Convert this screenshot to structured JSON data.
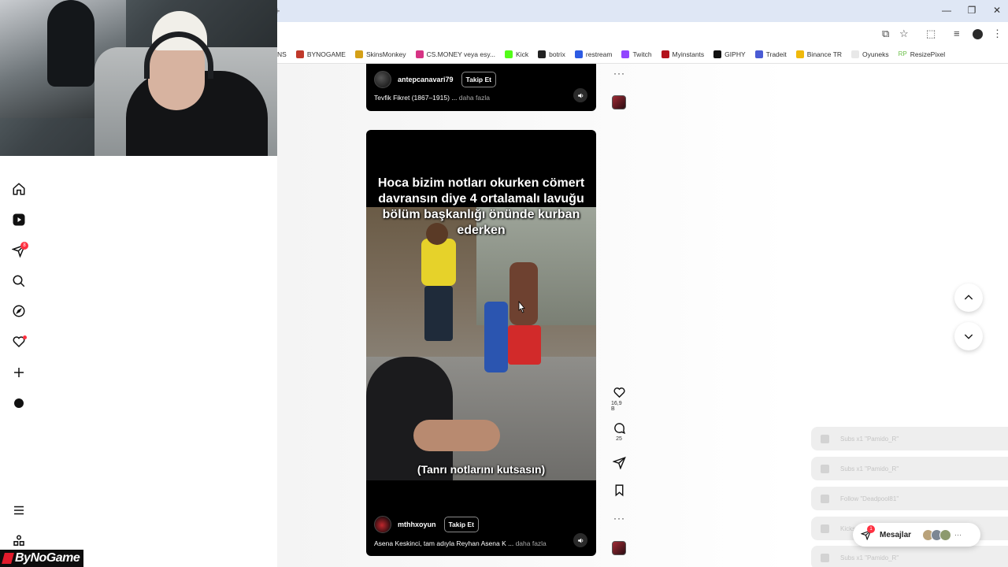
{
  "browser": {
    "bookmarks": [
      {
        "label": "NS",
        "color": "#ffffff"
      },
      {
        "label": "BYNOGAME",
        "color": "#c0392b"
      },
      {
        "label": "SkinsMonkey",
        "color": "#d4a017"
      },
      {
        "label": "CS.MONEY veya esy...",
        "color": "#d63384"
      },
      {
        "label": "Kick",
        "color": "#53fc18"
      },
      {
        "label": "botrix",
        "color": "#222222"
      },
      {
        "label": "restream",
        "color": "#2d5be3"
      },
      {
        "label": "Twitch",
        "color": "#9146ff"
      },
      {
        "label": "Myinstants",
        "color": "#b3121b"
      },
      {
        "label": "GIPHY",
        "color": "#111111"
      },
      {
        "label": "Tradeit",
        "color": "#4a5bd4"
      },
      {
        "label": "Binance TR",
        "color": "#f0b90b"
      },
      {
        "label": "Oyuneks",
        "color": "#e8e8e8"
      },
      {
        "label": "ResizePixel",
        "color": "#6cc04a"
      }
    ],
    "bookmark_prefix_rp": "RP"
  },
  "nav": {
    "notification_count": "8"
  },
  "reel_top": {
    "author": "antepcanavari79",
    "follow_label": "Takip Et",
    "description": "Tevfik Fikret (1867–1915) ...",
    "more_label": "daha fazla"
  },
  "reel_main": {
    "caption_top": "Hoca bizim notları okurken cömert davransın diye 4 ortalamalı lavuğu bölüm başkanlığı önünde kurban ederken",
    "caption_bottom": "(Tanrı notlarını kutsasın)",
    "author": "mthhxoyun",
    "follow_label": "Takip Et",
    "description": "Asena Keskinci, tam adıyla Reyhan Asena K ...",
    "more_label": "daha fazla"
  },
  "actions": {
    "likes": "16,9 B",
    "comments": "25",
    "more_dots": "···"
  },
  "alerts": [
    {
      "text": "Subs x1 \"Pamido_R\""
    },
    {
      "text": "Subs x1 \"Pamido_R\""
    },
    {
      "text": "Follow \"Deadpool81\""
    },
    {
      "text": "Kicks x1 \"Daymat_34\""
    },
    {
      "text": "Subs x1 \"Pamido_R\""
    }
  ],
  "messages": {
    "label": "Mesajlar",
    "badge": "1",
    "more": "···"
  },
  "watermark": "ByNoGame"
}
